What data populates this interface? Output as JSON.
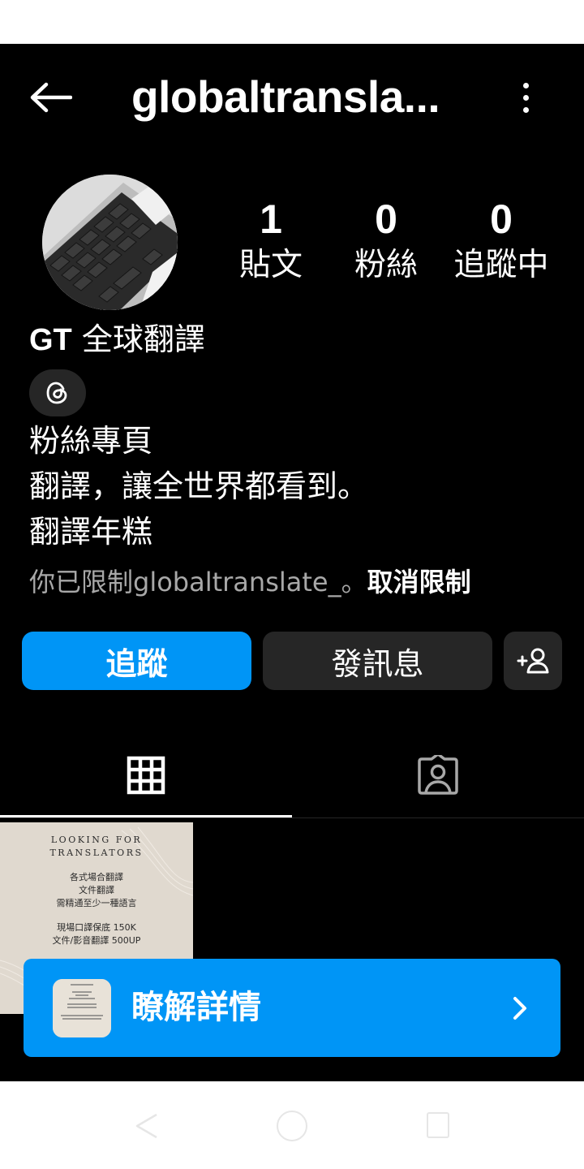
{
  "header": {
    "username": "globaltransla...",
    "back_icon": "arrow-left-icon",
    "more_icon": "more-vertical-icon"
  },
  "profile": {
    "avatar_desc": "laptop-keyboard-photo",
    "stats": [
      {
        "value": "1",
        "label": "貼文"
      },
      {
        "value": "0",
        "label": "粉絲"
      },
      {
        "value": "0",
        "label": "追蹤中"
      }
    ],
    "display_name_latin": "GT",
    "display_name_cjk": " 全球翻譯",
    "threads_icon": "threads-icon",
    "bio": [
      "粉絲專頁",
      "翻譯，讓全世界都看到。",
      "翻譯年糕"
    ],
    "restricted_text": "你已限制globaltranslate_。",
    "unrestrict_label": "取消限制"
  },
  "actions": {
    "follow_label": "追蹤",
    "message_label": "發訊息",
    "suggest_icon": "add-person-icon"
  },
  "tabs": [
    {
      "name": "grid",
      "icon": "grid-icon",
      "active": true
    },
    {
      "name": "tagged",
      "icon": "tagged-person-icon",
      "active": false
    }
  ],
  "post": {
    "heading": [
      "LOOKING FOR",
      "TRANSLATORS"
    ],
    "body": [
      "各式場合翻譯",
      "文件翻譯",
      "需精通至少一種語言"
    ],
    "prices": [
      "現場口譯保底 150K",
      "文件/影音翻譯 500UP"
    ]
  },
  "cta": {
    "label": "瞭解詳情",
    "chevron_icon": "chevron-right-icon"
  },
  "colors": {
    "background": "#000000",
    "accent": "#0095f6",
    "button_dark": "#262626",
    "muted_text": "#a8a8a8"
  }
}
